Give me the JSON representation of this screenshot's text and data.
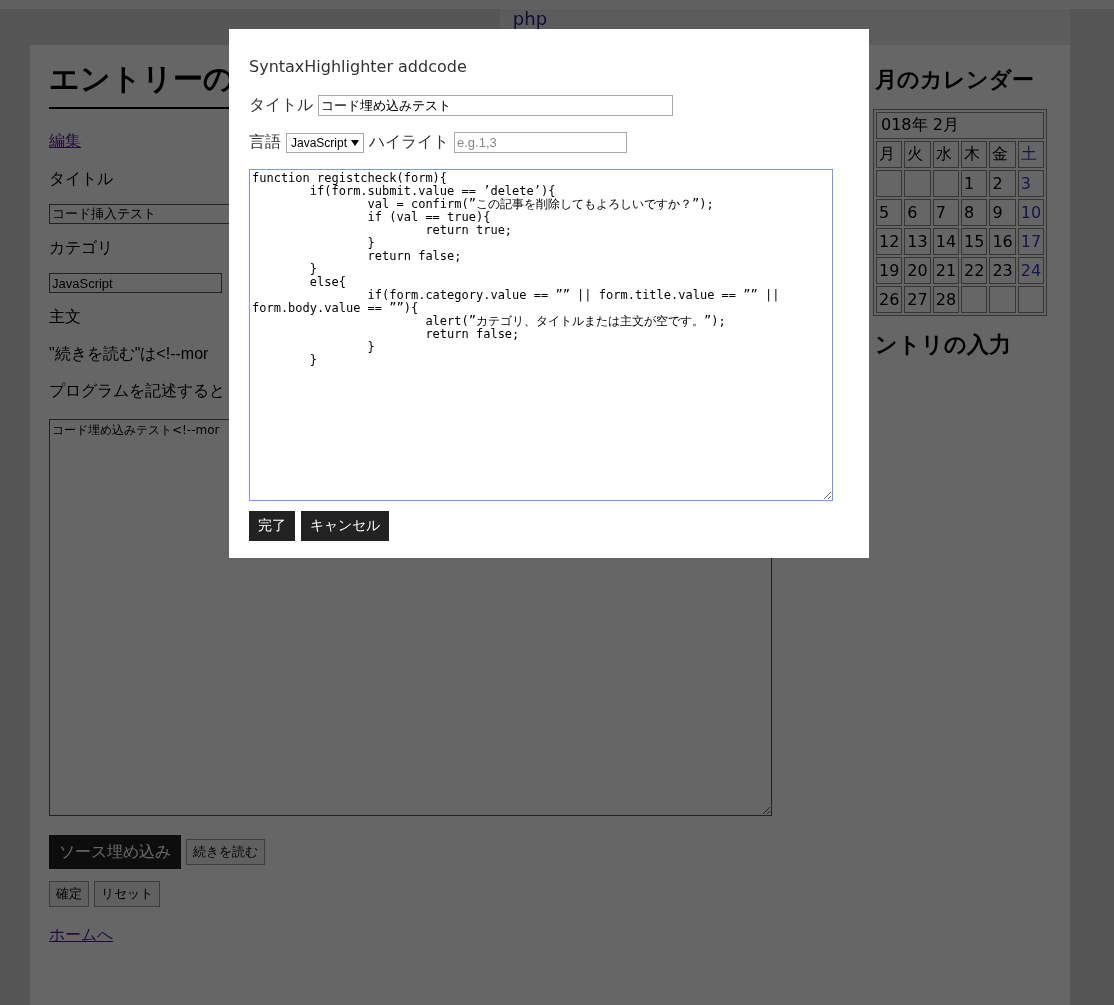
{
  "site_header": {
    "title": "php"
  },
  "entry_form": {
    "heading": "エントリーの",
    "edit_link": "編集",
    "title_label": "タイトル",
    "title_value": "コード挿入テスト",
    "category_label": "カテゴリ",
    "category_value": "JavaScript",
    "body_label": "主文",
    "notes": [
      "\"続きを読む\"は<!--mor",
      "プログラムを記述すると"
    ],
    "body_value": "コード埋め込みテスト<!--mor",
    "toolbar_buttons": [
      {
        "label": "ソース埋め込み",
        "kind": "primary"
      },
      {
        "label": "続きを読む",
        "kind": "plain"
      }
    ],
    "form_buttons": [
      "確定",
      "リセット"
    ],
    "home_link": "ホームへ"
  },
  "sidebar": {
    "calendar_heading": "月のカレンダー",
    "calendar": {
      "caption": "018年 2月",
      "weekdays": [
        {
          "label": "月",
          "kind": "weekday"
        },
        {
          "label": "火",
          "kind": "weekday"
        },
        {
          "label": "水",
          "kind": "weekday"
        },
        {
          "label": "木",
          "kind": "weekday"
        },
        {
          "label": "金",
          "kind": "weekday"
        },
        {
          "label": "土",
          "kind": "saturday"
        }
      ],
      "weeks": [
        [
          {
            "kind": "blank"
          },
          {
            "kind": "blank"
          },
          {
            "kind": "blank"
          },
          {
            "kind": "day",
            "day": "1"
          },
          {
            "kind": "day",
            "day": "2"
          },
          {
            "kind": "day",
            "day": "3"
          }
        ],
        [
          {
            "kind": "day",
            "day": "5"
          },
          {
            "kind": "day",
            "day": "6"
          },
          {
            "kind": "day",
            "day": "7"
          },
          {
            "kind": "day",
            "day": "8"
          },
          {
            "kind": "day",
            "day": "9"
          },
          {
            "kind": "day",
            "day": "10"
          }
        ],
        [
          {
            "kind": "day",
            "day": "12"
          },
          {
            "kind": "day",
            "day": "13"
          },
          {
            "kind": "day",
            "day": "14"
          },
          {
            "kind": "day",
            "day": "15"
          },
          {
            "kind": "day",
            "day": "16"
          },
          {
            "kind": "day",
            "day": "17"
          }
        ],
        [
          {
            "kind": "day",
            "day": "19"
          },
          {
            "kind": "day",
            "day": "20"
          },
          {
            "kind": "day",
            "day": "21"
          },
          {
            "kind": "day",
            "day": "22"
          },
          {
            "kind": "day",
            "day": "23"
          },
          {
            "kind": "day",
            "day": "24"
          }
        ],
        [
          {
            "kind": "day",
            "day": "26"
          },
          {
            "kind": "day",
            "day": "27"
          },
          {
            "kind": "day",
            "day": "28"
          },
          {
            "kind": "blank"
          },
          {
            "kind": "blank"
          },
          {
            "kind": "blank"
          }
        ]
      ]
    },
    "entry_heading": "ントリの入力"
  },
  "dialog": {
    "title": "SyntaxHighlighter addcode",
    "title_label": "タイトル",
    "title_value": "コード埋め込みテスト",
    "language_label": "言語",
    "language_value": "JavaScript",
    "highlight_label": "ハイライト",
    "highlight_placeholder": "e.g.1,3",
    "code": "function registcheck(form){\n\tif(form.submit.value == ’delete’){\n\t\tval = confirm(”この記事を削除してもよろしいですか？”);\n\t\tif (val == true){\n\t\t\treturn true;\n\t\t}\n\t\treturn false;\n\t}\n\telse{\n\t\tif(form.category.value == ”” || form.title.value == ”” || form.body.value == ””){\n\t\t\talert(”カテゴリ、タイトルまたは主文が空です。”);\n\t\t\treturn false;\n\t\t}\n\t}",
    "buttons": [
      "完了",
      "キャンセル"
    ]
  }
}
